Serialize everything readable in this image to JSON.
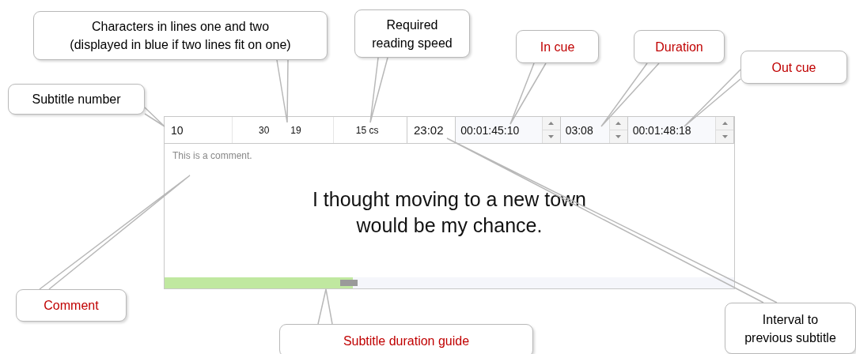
{
  "editor": {
    "subtitle_number": "10",
    "chars_line_one": "30",
    "chars_line_two": "19",
    "reading_speed": "15 cs",
    "interval": "23:02",
    "in_cue": "00:01:45:10",
    "duration": "03:08",
    "out_cue": "00:01:48:18",
    "comment": "This is a comment.",
    "subtitle_lines": [
      "I thought moving to a new town",
      "would be my chance."
    ],
    "duration_guide": {
      "level": 0.33
    }
  },
  "callouts": [
    {
      "lines": [
        "Subtitle number"
      ],
      "color": "#000000"
    },
    {
      "lines": [
        "Characters in lines one and two",
        "(displayed in blue if two lines fit on one)"
      ],
      "color": "#000000"
    },
    {
      "lines": [
        "Required",
        "reading speed"
      ],
      "color": "#000000"
    },
    {
      "lines": [
        "In cue"
      ],
      "color": "#c00000"
    },
    {
      "lines": [
        "Duration"
      ],
      "color": "#c00000"
    },
    {
      "lines": [
        "Out cue"
      ],
      "color": "#c00000"
    },
    {
      "lines": [
        "Comment"
      ],
      "color": "#c00000"
    },
    {
      "lines": [
        "Subtitle duration guide"
      ],
      "color": "#c00000"
    },
    {
      "lines": [
        "Interval to",
        "previous subtitle"
      ],
      "color": "#000000"
    }
  ]
}
